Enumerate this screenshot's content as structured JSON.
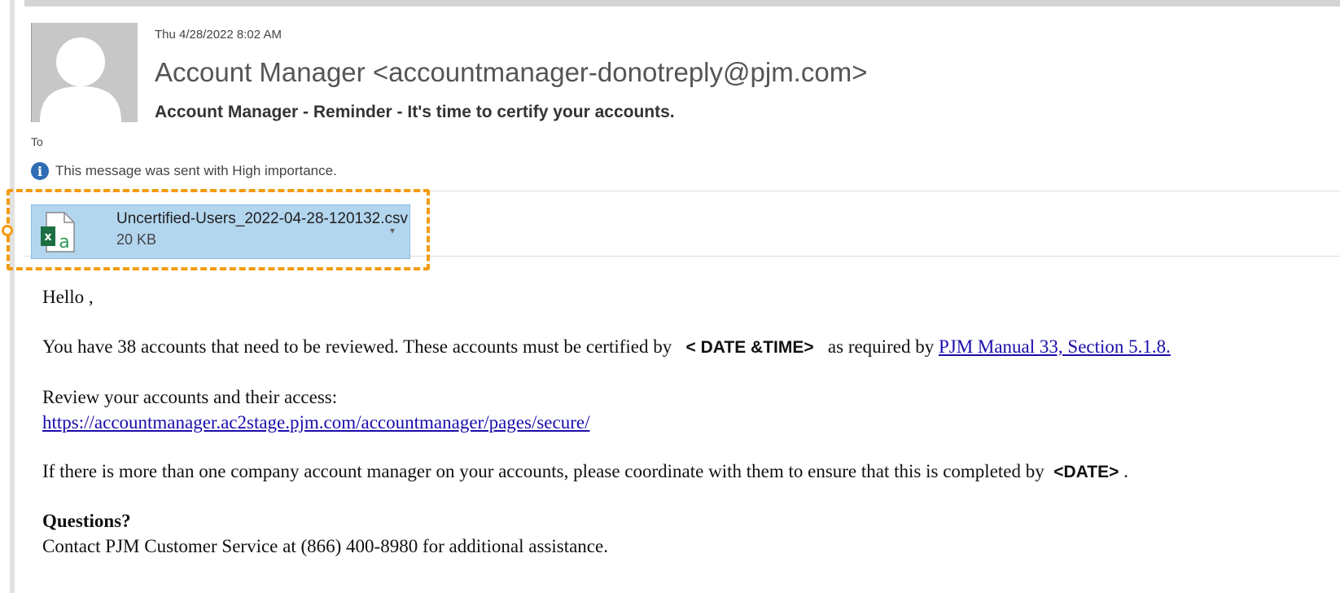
{
  "message": {
    "date": "Thu 4/28/2022 8:02 AM",
    "sender": "Account Manager <accountmanager-donotreply@pjm.com>",
    "subject": "Account Manager - Reminder - It's time to certify your accounts.",
    "to_label": "To",
    "importance_notice": "This message was sent with High importance."
  },
  "attachment": {
    "file_name": "Uncertified-Users_2022-04-28-120132.csv",
    "file_size": "20 KB",
    "icon": "excel-csv-icon"
  },
  "body": {
    "greeting": "Hello ,",
    "line1_prefix": "You have 38 accounts that need to be reviewed. These accounts must be certified by",
    "line1_placeholder": "< DATE &TIME>",
    "line1_middle": "as required by",
    "line1_link": "PJM Manual 33, Section 5.1.8.",
    "review_label": "Review your accounts and their access:",
    "review_url": "https://accountmanager.ac2stage.pjm.com/accountmanager/pages/secure/",
    "coordinate_prefix": "If there is more than one company account manager on your accounts, please coordinate with them to ensure that this is completed by",
    "coordinate_placeholder": "<DATE>",
    "coordinate_suffix": ".",
    "questions_heading": "Questions?",
    "contact_line": "Contact PJM Customer Service at (866) 400-8980 for additional assistance."
  },
  "colors": {
    "highlight": "#f39c12",
    "attachment_bg": "#b3d6ef",
    "link": "#1a0dab",
    "info_icon": "#2f6db5"
  }
}
